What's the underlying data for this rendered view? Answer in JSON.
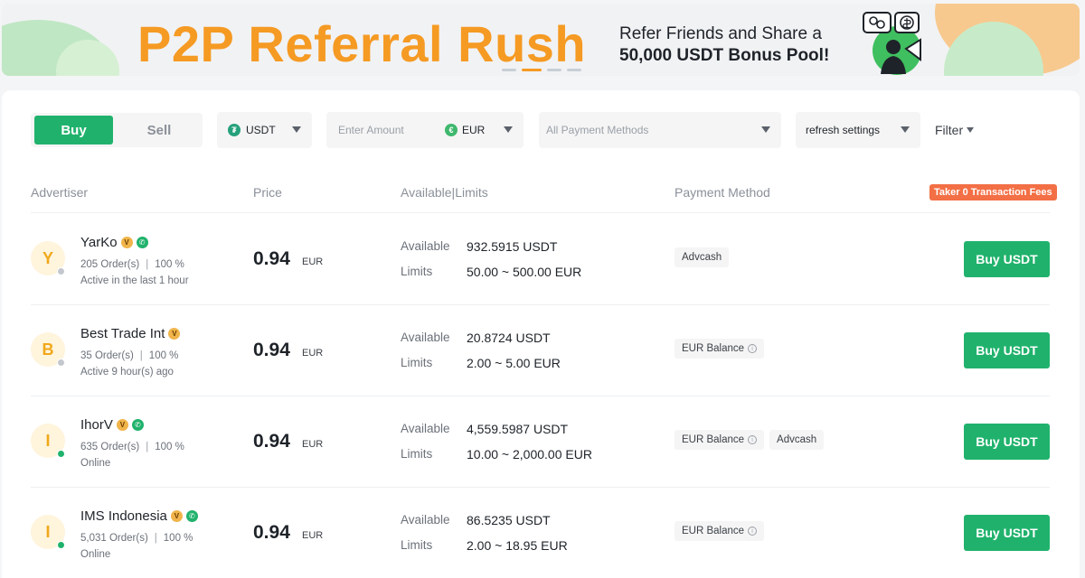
{
  "banner": {
    "title": "P2P Referral Rush",
    "subtitle_line1": "Refer Friends and Share a",
    "subtitle_line2": "50,000 USDT Bonus Pool!"
  },
  "trade_toggle": {
    "buy_label": "Buy",
    "sell_label": "Sell"
  },
  "filters": {
    "coin_label": "USDT",
    "amount_placeholder": "Enter Amount",
    "fiat_label": "EUR",
    "payment_placeholder": "All Payment Methods",
    "refresh_label": "refresh settings",
    "filter_label": "Filter"
  },
  "table_header": {
    "advertiser": "Advertiser",
    "price": "Price",
    "available_limits": "Available|Limits",
    "payment_method": "Payment Method",
    "fee_badge": "Taker 0 Transaction Fees"
  },
  "labels": {
    "available": "Available",
    "limits": "Limits"
  },
  "rows": [
    {
      "initial": "Y",
      "name": "YarKo",
      "phone_verified": true,
      "online": false,
      "orders": "205 Order(s)",
      "completion": "100 %",
      "activity": "Active in the last 1 hour",
      "price": "0.94",
      "currency": "EUR",
      "available": "932.5915 USDT",
      "limits": "50.00 ~ 500.00 EUR",
      "payments": [
        "Advcash"
      ],
      "button": "Buy USDT"
    },
    {
      "initial": "B",
      "name": "Best Trade Int",
      "phone_verified": false,
      "online": false,
      "orders": "35 Order(s)",
      "completion": "100 %",
      "activity": "Active 9 hour(s) ago",
      "price": "0.94",
      "currency": "EUR",
      "available": "20.8724 USDT",
      "limits": "2.00 ~ 5.00 EUR",
      "payments": [
        "EUR Balance"
      ],
      "button": "Buy USDT"
    },
    {
      "initial": "I",
      "name": "IhorV",
      "phone_verified": true,
      "online": true,
      "orders": "635 Order(s)",
      "completion": "100 %",
      "activity": "Online",
      "price": "0.94",
      "currency": "EUR",
      "available": "4,559.5987 USDT",
      "limits": "10.00 ~ 2,000.00 EUR",
      "payments": [
        "EUR Balance",
        "Advcash"
      ],
      "button": "Buy USDT"
    },
    {
      "initial": "I",
      "name": "IMS Indonesia",
      "phone_verified": true,
      "online": true,
      "orders": "5,031 Order(s)",
      "completion": "100 %",
      "activity": "Online",
      "price": "0.94",
      "currency": "EUR",
      "available": "86.5235 USDT",
      "limits": "2.00 ~ 18.95 EUR",
      "payments": [
        "EUR Balance"
      ],
      "button": "Buy USDT"
    }
  ],
  "colors": {
    "brand_green": "#20b26c",
    "banner_orange": "#f59a23",
    "fee_badge": "#f36f45"
  }
}
